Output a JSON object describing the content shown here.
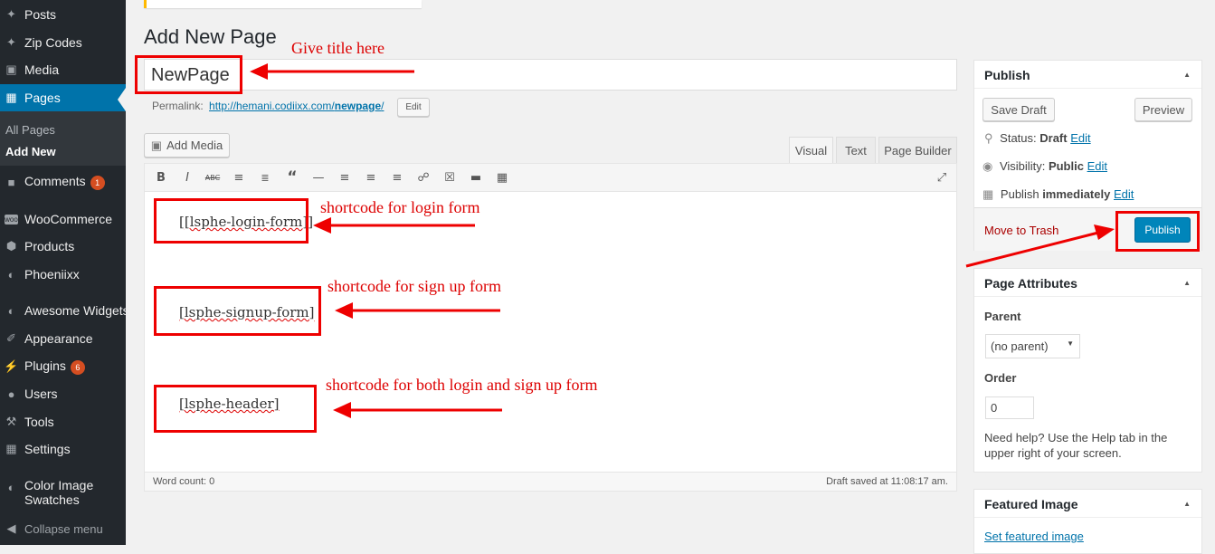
{
  "sidebar": {
    "items": [
      {
        "label": "Posts",
        "icon": "pin-icon"
      },
      {
        "label": "Zip Codes",
        "icon": "pin-icon"
      },
      {
        "label": "Media",
        "icon": "media-icon"
      },
      {
        "label": "Pages",
        "icon": "pages-icon"
      },
      {
        "label": "Comments",
        "icon": "comment-icon",
        "badge": "1"
      },
      {
        "label": "WooCommerce",
        "icon": "woo-icon"
      },
      {
        "label": "Products",
        "icon": "box-icon"
      },
      {
        "label": "Phoeniixx",
        "icon": "circle-icon"
      },
      {
        "label": "Awesome Widgets",
        "icon": "circle-icon"
      },
      {
        "label": "Appearance",
        "icon": "brush-icon"
      },
      {
        "label": "Plugins",
        "icon": "plug-icon",
        "badge": "6"
      },
      {
        "label": "Users",
        "icon": "user-icon"
      },
      {
        "label": "Tools",
        "icon": "wrench-icon"
      },
      {
        "label": "Settings",
        "icon": "settings-icon"
      },
      {
        "label": "Color Image Swatches",
        "icon": "circle-icon"
      },
      {
        "label": "Collapse menu",
        "icon": "collapse-icon"
      }
    ],
    "submenu": [
      "All Pages",
      "Add New"
    ]
  },
  "page": {
    "heading": "Add New Page",
    "title_value": "NewPage",
    "permalink_label": "Permalink:",
    "permalink_url_prefix": "http://hemani.codiixx.com/",
    "permalink_slug": "newpage",
    "permalink_suffix": "/",
    "permalink_edit": "Edit",
    "add_media": "Add Media"
  },
  "editor": {
    "tabs": [
      "Visual",
      "Text",
      "Page Builder"
    ],
    "shortcodes": [
      "[lsphe-login-form]",
      "[lsphe-signup-form]",
      "[lsphe-header]"
    ],
    "word_count": "Word count: 0",
    "draft_saved": "Draft saved at 11:08:17 am."
  },
  "publish": {
    "title": "Publish",
    "save_draft": "Save Draft",
    "preview": "Preview",
    "status_label": "Status:",
    "status_value": "Draft",
    "visibility_label": "Visibility:",
    "visibility_value": "Public",
    "publish_label": "Publish",
    "publish_value": "immediately",
    "edit": "Edit",
    "trash": "Move to Trash",
    "publish_button": "Publish"
  },
  "attributes": {
    "title": "Page Attributes",
    "parent_label": "Parent",
    "parent_value": "(no parent)",
    "order_label": "Order",
    "order_value": "0",
    "help": "Need help? Use the Help tab in the upper right of your screen."
  },
  "featured": {
    "title": "Featured Image",
    "link": "Set featured image"
  },
  "annotations": {
    "title": "Give title here",
    "login": "shortcode for login form",
    "signup": "shortcode for sign up form",
    "both": "shortcode for both login and sign up form"
  },
  "colors": {
    "accent": "#0073aa",
    "sidebar": "#23282d",
    "annotation": "#dd0000",
    "badge": "#d54e21"
  }
}
